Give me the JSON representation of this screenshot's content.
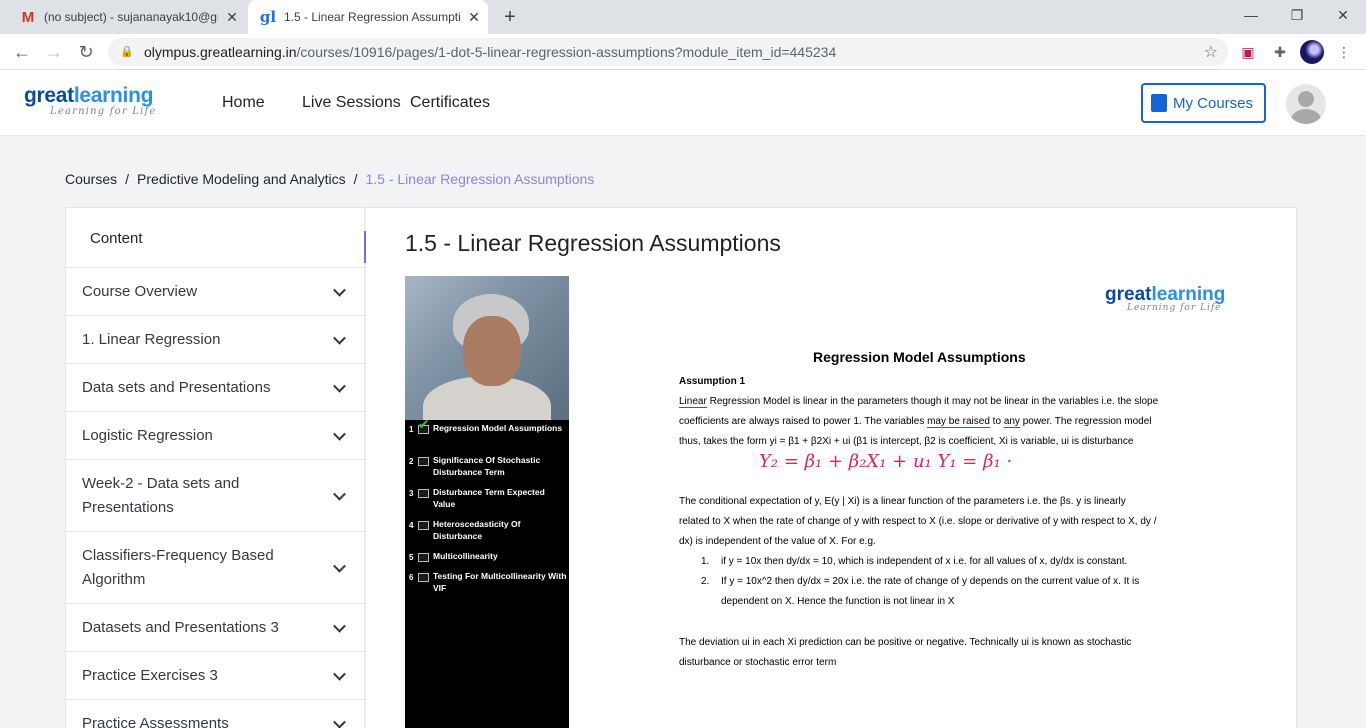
{
  "browser": {
    "tabs": [
      {
        "title": "(no subject) - sujananayak10@gr",
        "icon": "gmail-icon",
        "active": false
      },
      {
        "title": "1.5 - Linear Regression Assumptio",
        "icon": "greatlearning-icon",
        "active": true
      }
    ],
    "new_tab": "+",
    "window_controls": {
      "minimize": "—",
      "restore": "❐",
      "close": "✕"
    },
    "url_host": "olympus.greatlearning.in",
    "url_path": "/courses/10916/pages/1-dot-5-linear-regression-assumptions?module_item_id=445234"
  },
  "site": {
    "logo_word1": "great",
    "logo_word2": "learning",
    "logo_tagline": "Learning for Life",
    "nav": [
      "Home",
      "Live Sessions",
      "Certificates"
    ],
    "my_courses": "My Courses",
    "colors": {
      "primary": "#1565d8",
      "accent": "#6e6cf2",
      "breadcrumb_current": "#8b84e0"
    }
  },
  "breadcrumb": {
    "items": [
      "Courses",
      "Predictive Modeling and Analytics"
    ],
    "current": "1.5 - Linear Regression Assumptions",
    "separator": "/"
  },
  "sidebar": {
    "heading": "Content",
    "items": [
      {
        "label": "Course Overview"
      },
      {
        "label": "1. Linear Regression"
      },
      {
        "label": "Data sets and Presentations"
      },
      {
        "label": "Logistic Regression"
      },
      {
        "label": "Week-2 - Data sets and Presentations"
      },
      {
        "label": "Classifiers-Frequency Based Algorithm"
      },
      {
        "label": "Datasets and Presentations 3"
      },
      {
        "label": "Practice Exercises 3"
      },
      {
        "label": "Practice Assessments"
      }
    ],
    "collapse_label": "«"
  },
  "page": {
    "title": "1.5 - Linear Regression Assumptions"
  },
  "video_toc": [
    {
      "num": "1",
      "label": "Regression Model Assumptions",
      "checked": true
    },
    {
      "num": "2",
      "label": "Significance Of Stochastic Disturbance Term",
      "checked": false
    },
    {
      "num": "3",
      "label": "Disturbance Term Expected Value",
      "checked": false
    },
    {
      "num": "4",
      "label": "Heteroscedasticity Of Disturbance",
      "checked": false
    },
    {
      "num": "5",
      "label": "Multicollinearity",
      "checked": false
    },
    {
      "num": "6",
      "label": "Testing For Multicollinearity With VIF",
      "checked": false
    }
  ],
  "slide": {
    "heading": "Regression Model Assumptions",
    "assumption_label": "Assumption 1",
    "p1_a": "Linear",
    "p1_b": " Regression Model is linear in the parameters though it may not be linear in the variables i.e. the slope coefficients are always raised to power 1. The variables ",
    "p1_c": "may be raised",
    "p1_d": " to ",
    "p1_e": "any",
    "p1_f": " power. The regression model thus, takes the form   yi = β1 + β2Xi  + ui  (β1 is intercept, β2 is coefficient, Xi is variable, ui is disturbance",
    "handwriting": "Y₂ = β₁ + β₂X₁ + u₁      Y₁ = β₁ ·",
    "p2": "The conditional expectation of y, E(y | Xi) is a linear function of the parameters i.e. the βs. y is linearly related to X when the rate of change of y with respect to X (i.e. slope or derivative of y with respect to X,  dy / dx) is independent of the value of X.  For e.g.",
    "list": [
      {
        "num": "1.",
        "text": "if  y = 10x  then dy/dx  = 10, which is independent of x i.e. for all values of x, dy/dx is constant."
      },
      {
        "num": "2.",
        "text": "If y = 10x^2  then dy/dx = 20x i.e. the rate of change of y depends on the current value of x. It is dependent on X. Hence the function is not linear in X"
      }
    ],
    "p3": "The deviation ui in each Xi prediction can be positive or negative. Technically  ui is known as stochastic disturbance or stochastic error term"
  }
}
